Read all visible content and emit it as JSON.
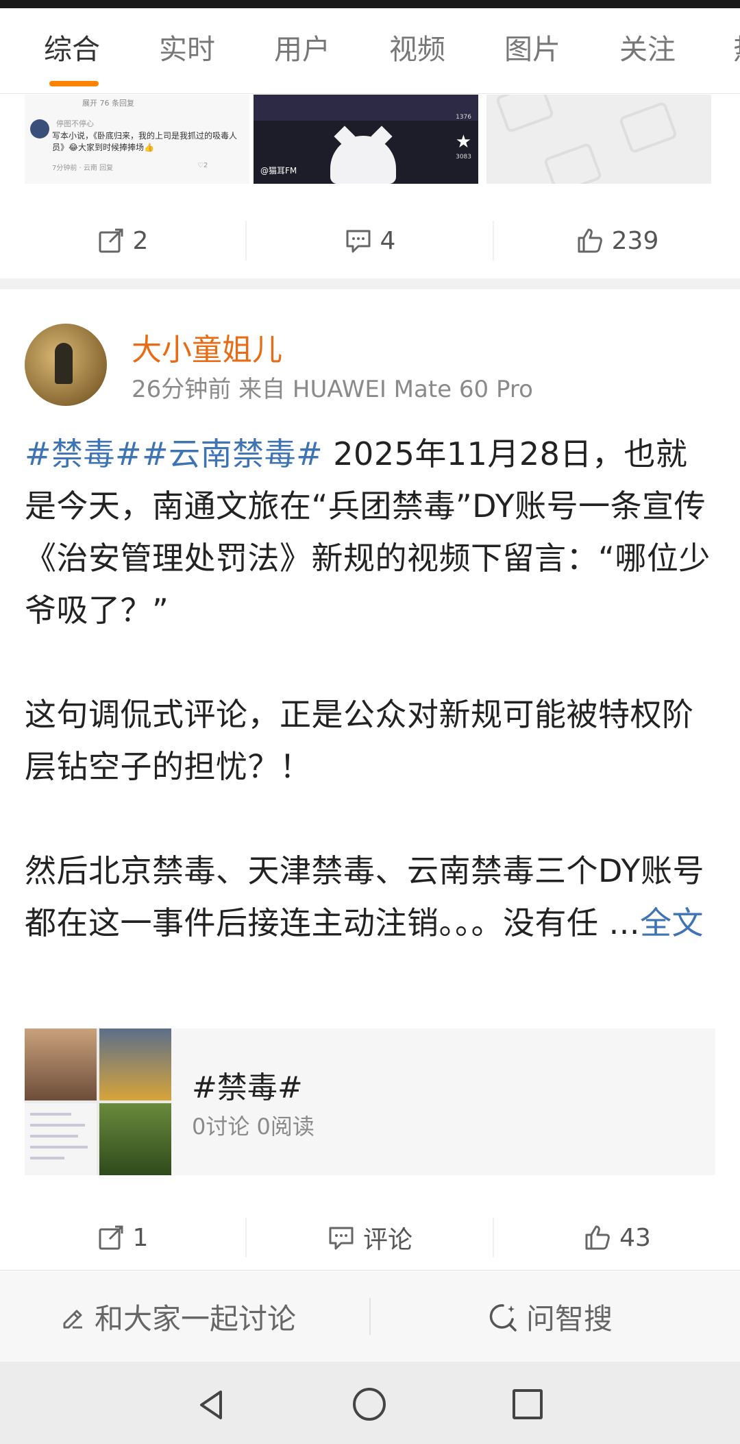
{
  "tabs": [
    "综合",
    "实时",
    "用户",
    "视频",
    "图片",
    "关注",
    "热"
  ],
  "active_tab": 0,
  "prev_post": {
    "thumb1": {
      "header": "展开 76 条回复",
      "user": "停图不停心",
      "text": "写本小说，《卧底归来，我的上司是我抓过的吸毒人员》😂大家到时候捧捧场👍",
      "meta": "7分钟前 · 云南   回复",
      "likes": "♡2"
    },
    "thumb2": {
      "tag": "@猫耳FM",
      "count_top": "1376",
      "count_star": "3083"
    },
    "actions": {
      "repost": "2",
      "comment": "4",
      "like": "239"
    }
  },
  "post": {
    "author": "大小童姐儿",
    "meta": "26分钟前  来自 HUAWEI Mate 60 Pro",
    "hashtags": "#禁毒##云南禁毒#",
    "para1_rest": " 2025年11月28日，也就是今天，南通文旅在“兵团禁毒”DY账号一条宣传《治安管理处罚法》新规的视频下留言：“哪位少爷吸了？”",
    "para2": "这句调侃式评论，正是公众对新规可能被特权阶层钻空子的担忧？！",
    "para3": "然后北京禁毒、天津禁毒、云南禁毒三个DY账号都在这一事件后接连主动注销。。。没有任 ...",
    "more": "全文",
    "topic": {
      "title": "#禁毒#",
      "meta": "0讨论 0阅读"
    },
    "actions": {
      "repost": "1",
      "comment": "评论",
      "like": "43"
    }
  },
  "bottom_bar": {
    "discuss": "和大家一起讨论",
    "search": "问智搜"
  }
}
